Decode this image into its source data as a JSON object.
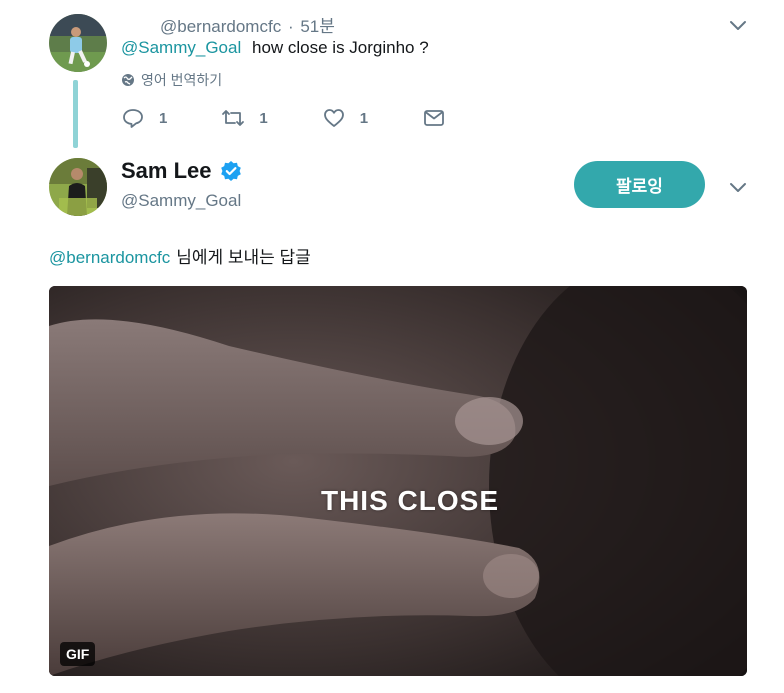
{
  "parent_tweet": {
    "handle": "@bernardomcfc",
    "separator": "·",
    "time": "51분",
    "mention": "@Sammy_Goal",
    "text": "how close is Jorginho ?",
    "translate_label": "영어 번역하기",
    "actions": {
      "reply_count": "1",
      "retweet_count": "1",
      "like_count": "1"
    },
    "icons": [
      "chevron-down-icon",
      "globe-icon",
      "reply-icon",
      "retweet-icon",
      "heart-icon",
      "envelope-icon"
    ]
  },
  "main_tweet": {
    "display_name": "Sam Lee",
    "handle": "@Sammy_Goal",
    "follow_label": "팔로잉",
    "reply_mention": "@bernardomcfc",
    "reply_text": "님에게 보내는 답글",
    "media": {
      "caption": "THIS CLOSE",
      "badge": "GIF"
    },
    "icons": [
      "verified-badge-icon",
      "chevron-down-icon"
    ]
  },
  "colors": {
    "accent": "#1b95a0",
    "follow_button": "#33a8ac",
    "muted_text": "#657786",
    "thread_line": "#8fd3d6",
    "verified": "#1da1f2"
  }
}
